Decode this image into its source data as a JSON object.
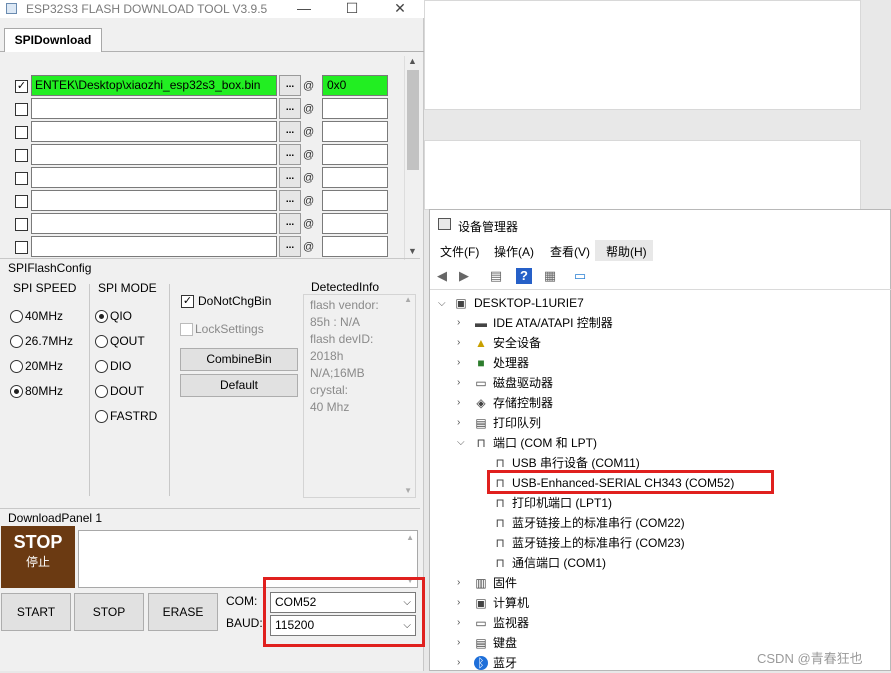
{
  "flash_tool": {
    "title": "ESP32S3 FLASH DOWNLOAD TOOL V3.9.5",
    "window_controls": {
      "minimize": "—",
      "maximize": "☐",
      "close": "✕"
    },
    "tab": "SPIDownload",
    "rows": [
      {
        "checked": true,
        "path": "ENTEK\\Desktop\\xiaozhi_esp32s3_box.bin",
        "browse": "...",
        "at": "@",
        "address": "0x0"
      },
      {
        "checked": false,
        "path": "",
        "browse": "...",
        "at": "@",
        "address": ""
      },
      {
        "checked": false,
        "path": "",
        "browse": "...",
        "at": "@",
        "address": ""
      },
      {
        "checked": false,
        "path": "",
        "browse": "...",
        "at": "@",
        "address": ""
      },
      {
        "checked": false,
        "path": "",
        "browse": "...",
        "at": "@",
        "address": ""
      },
      {
        "checked": false,
        "path": "",
        "browse": "...",
        "at": "@",
        "address": ""
      },
      {
        "checked": false,
        "path": "",
        "browse": "...",
        "at": "@",
        "address": ""
      },
      {
        "checked": false,
        "path": "",
        "browse": "...",
        "at": "@",
        "address": ""
      }
    ],
    "highlight_color": "#22ee22",
    "spi_flash_config": {
      "label": "SPIFlashConfig",
      "spi_speed": {
        "label": "SPI SPEED",
        "options": [
          "40MHz",
          "26.7MHz",
          "20MHz",
          "80MHz"
        ],
        "selected": "80MHz"
      },
      "spi_mode": {
        "label": "SPI MODE",
        "options": [
          "QIO",
          "QOUT",
          "DIO",
          "DOUT",
          "FASTRD"
        ],
        "selected": "QIO"
      },
      "do_not_chg_bin": {
        "label": "DoNotChgBin",
        "checked": true
      },
      "lock_settings": {
        "label": "LockSettings",
        "checked": false
      },
      "combine_bin": "CombineBin",
      "default": "Default",
      "detected_info": {
        "label": "DetectedInfo",
        "text": "flash vendor:\n85h : N/A\nflash devID:\n2018h\nN/A;16MB\ncrystal:\n40 Mhz"
      }
    },
    "download_panel": {
      "label": "DownloadPanel 1",
      "stop_en": "STOP",
      "stop_zh": "停止",
      "start": "START",
      "stop": "STOP",
      "erase": "ERASE",
      "com_label": "COM:",
      "com_value": "COM52",
      "baud_label": "BAUD:",
      "baud_value": "115200"
    }
  },
  "device_manager": {
    "title": "设备管理器",
    "menu": [
      "文件(F)",
      "操作(A)",
      "查看(V)",
      "帮助(H)"
    ],
    "tree": {
      "root": "DESKTOP-L1URIE7",
      "items": [
        {
          "label": "IDE ATA/ATAPI 控制器",
          "icon": "ide-controller-icon"
        },
        {
          "label": "安全设备",
          "icon": "security-device-icon"
        },
        {
          "label": "处理器",
          "icon": "processor-icon"
        },
        {
          "label": "磁盘驱动器",
          "icon": "disk-drive-icon"
        },
        {
          "label": "存储控制器",
          "icon": "storage-controller-icon"
        },
        {
          "label": "打印队列",
          "icon": "print-queue-icon"
        },
        {
          "label": "端口 (COM 和 LPT)",
          "icon": "port-icon",
          "expanded": true,
          "children": [
            "USB 串行设备 (COM11)",
            "USB-Enhanced-SERIAL CH343 (COM52)",
            "打印机端口 (LPT1)",
            "蓝牙链接上的标准串行 (COM22)",
            "蓝牙链接上的标准串行 (COM23)",
            "通信端口 (COM1)"
          ]
        },
        {
          "label": "固件",
          "icon": "firmware-icon"
        },
        {
          "label": "计算机",
          "icon": "computer-icon"
        },
        {
          "label": "监视器",
          "icon": "monitor-icon"
        },
        {
          "label": "键盘",
          "icon": "keyboard-icon"
        },
        {
          "label": "蓝牙",
          "icon": "bluetooth-icon"
        }
      ]
    }
  },
  "highlight_red": "#e0201e",
  "watermark": "CSDN @青春狂也"
}
